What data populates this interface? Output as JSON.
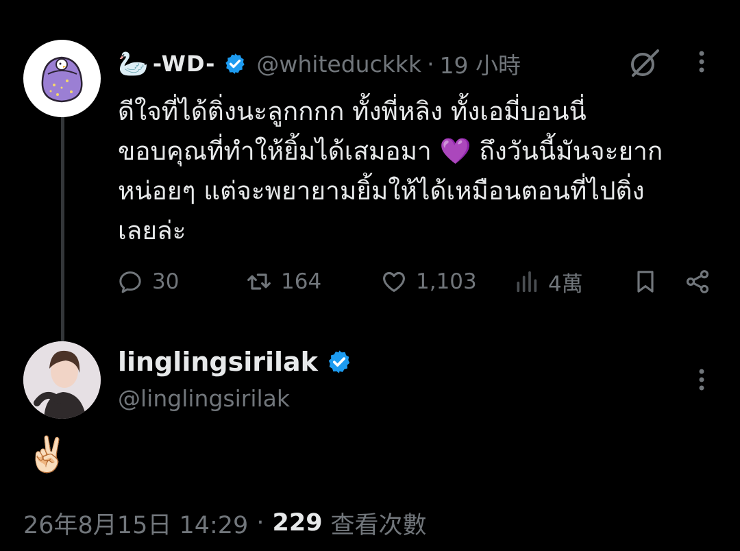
{
  "tweet": {
    "display_name": "-WD-",
    "handle": "@whiteduckkk",
    "separator": "·",
    "time": "19 小時",
    "text": "ดีใจที่ได้ติ่งนะลูกกกก ทั้งพี่หลิง ทั้งเอมี่บอนนี่\nขอบคุณที่ทำให้ยิ้มได้เสมอมา 💜 ถึงวันนี้มันจะยาก\nหน่อยๆ แต่จะพยายามยิ้มให้ได้เหมือนตอนที่ไปติ่ง\nเลยล่ะ",
    "actions": {
      "replies": "30",
      "reposts": "164",
      "likes": "1,103",
      "views": "4萬"
    }
  },
  "reply": {
    "display_name": "linglingsirilak",
    "handle": "@linglingsirilak",
    "text": "✌🏻"
  },
  "footer": {
    "timestamp": "26年8月15日 14:29",
    "separator": "·",
    "view_count": "229",
    "view_label": "查看次數"
  },
  "colors": {
    "background": "#000000",
    "text_primary": "#e7e9ea",
    "text_secondary": "#71767b",
    "verified": "#1d9bf0",
    "thread_line": "#333639"
  },
  "icons": [
    "goose-emoji",
    "verified-badge-icon",
    "grok-icon",
    "more-icon",
    "reply-icon",
    "repost-icon",
    "like-icon",
    "views-icon",
    "bookmark-icon",
    "share-icon"
  ]
}
